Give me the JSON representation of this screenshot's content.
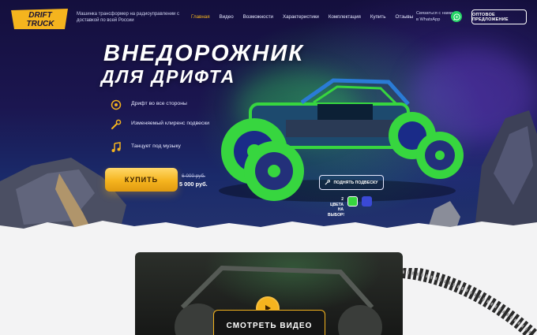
{
  "brand": {
    "logo_text_line1": "DRIFT",
    "logo_text_line2": "TRUCK",
    "tagline": "Машинка трансформер на радиоуправлении с доставкой по всей России"
  },
  "nav": {
    "items": [
      {
        "label": "Главная",
        "active": true
      },
      {
        "label": "Видео"
      },
      {
        "label": "Возможности"
      },
      {
        "label": "Характеристики"
      },
      {
        "label": "Комплектация"
      },
      {
        "label": "Купить"
      },
      {
        "label": "Отзывы"
      }
    ]
  },
  "contact": {
    "whatsapp_text": "Связаться с нами в WhatsApp"
  },
  "header": {
    "wholesale_label": "ОПТОВОЕ ПРЕДЛОЖЕНИЕ"
  },
  "hero": {
    "title_line1": "ВНЕДОРОЖНИК",
    "title_line2": "ДЛЯ ДРИФТА",
    "features": [
      {
        "icon": "wheel-icon",
        "text": "Дрифт во все стороны"
      },
      {
        "icon": "wrench-icon",
        "text": "Изменяемый клиренс подвески"
      },
      {
        "icon": "music-note-icon",
        "text": "Танцует под музыку"
      }
    ],
    "buy_label": "КУПИТЬ",
    "price_old": "6 000 руб.",
    "price_new": "5 000 руб.",
    "lift_label": "ПОДНЯТЬ ПОДВЕСКУ",
    "colors_label": "2 ЦВЕТА НА ВЫБОР!"
  },
  "video": {
    "label": "СМОТРЕТЬ ВИДЕО"
  },
  "colors": {
    "accent": "#f5b41e",
    "green": "#37d63f",
    "blue": "#3a49d6",
    "whatsapp": "#25d366"
  }
}
